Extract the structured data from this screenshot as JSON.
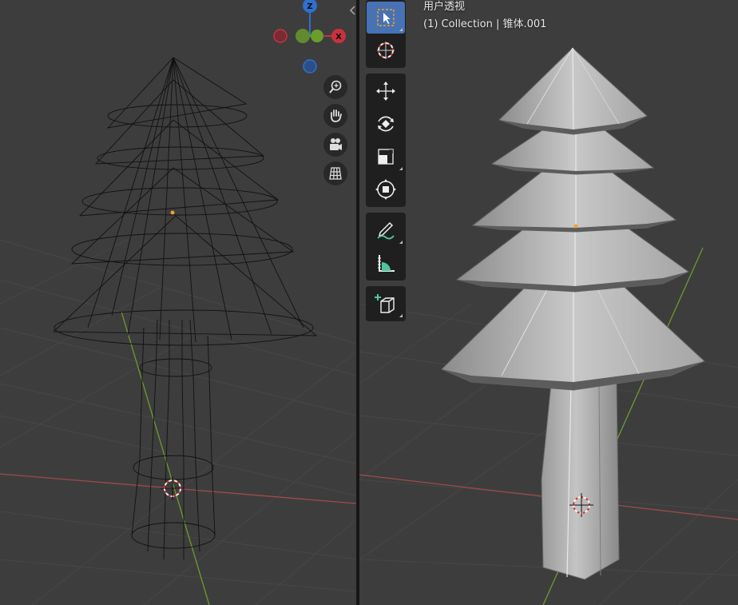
{
  "left_viewport": {
    "shading": "wireframe",
    "gizmo": {
      "z_label": "Z",
      "x_label": "X"
    },
    "nav_buttons": [
      "zoom-icon",
      "pan-hand-icon",
      "camera-icon",
      "grid-icon"
    ]
  },
  "right_viewport": {
    "shading": "solid",
    "view_name": "用户透视",
    "view_info": "(1) Collection | 锥体.001",
    "tools": [
      [
        "select-box-icon",
        "cursor-icon"
      ],
      [
        "move-icon",
        "rotate-icon",
        "scale-icon",
        "transform-icon"
      ],
      [
        "annotate-icon",
        "measure-icon"
      ],
      [
        "add-cube-icon"
      ]
    ]
  },
  "colors": {
    "background": "#3d3d3d",
    "grid": "#474747",
    "x_axis": "#a04a4f",
    "y_axis": "#6f9a32",
    "gizmo_z": "#2f6fcf",
    "gizmo_x": "#c8323c",
    "gizmo_y": "#6a9e2c",
    "active_tool": "#4772b3",
    "origin": "#f0a030"
  }
}
